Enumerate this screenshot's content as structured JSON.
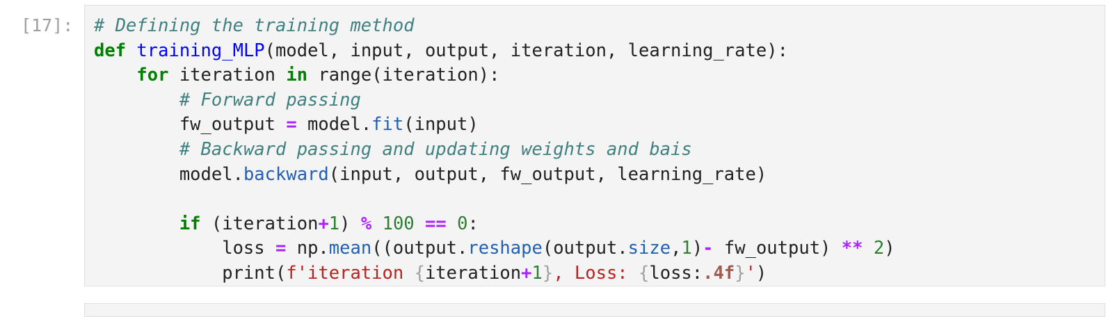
{
  "cell": {
    "prompt": "[17]:",
    "lines": [
      [
        {
          "t": "cm",
          "v": "# Defining the training method"
        }
      ],
      [
        {
          "t": "kw",
          "v": "def"
        },
        {
          "t": "tx",
          "v": " "
        },
        {
          "t": "fn",
          "v": "training_MLP"
        },
        {
          "t": "tx",
          "v": "(model, input, output, iteration, learning_rate):"
        }
      ],
      [
        {
          "t": "tx",
          "v": "    "
        },
        {
          "t": "kw",
          "v": "for"
        },
        {
          "t": "tx",
          "v": " iteration "
        },
        {
          "t": "kw",
          "v": "in"
        },
        {
          "t": "tx",
          "v": " range(iteration):"
        }
      ],
      [
        {
          "t": "tx",
          "v": "        "
        },
        {
          "t": "cm",
          "v": "# Forward passing"
        }
      ],
      [
        {
          "t": "tx",
          "v": "        fw_output "
        },
        {
          "t": "op",
          "v": "="
        },
        {
          "t": "tx",
          "v": " model."
        },
        {
          "t": "at",
          "v": "fit"
        },
        {
          "t": "tx",
          "v": "(input)"
        }
      ],
      [
        {
          "t": "tx",
          "v": "        "
        },
        {
          "t": "cm",
          "v": "# Backward passing and updating weights and bais"
        }
      ],
      [
        {
          "t": "tx",
          "v": "        model."
        },
        {
          "t": "at",
          "v": "backward"
        },
        {
          "t": "tx",
          "v": "(input, output, fw_output, learning_rate)"
        }
      ],
      [
        {
          "t": "tx",
          "v": ""
        }
      ],
      [
        {
          "t": "tx",
          "v": "        "
        },
        {
          "t": "kw",
          "v": "if"
        },
        {
          "t": "tx",
          "v": " (iteration"
        },
        {
          "t": "op",
          "v": "+"
        },
        {
          "t": "nm",
          "v": "1"
        },
        {
          "t": "tx",
          "v": ") "
        },
        {
          "t": "op",
          "v": "%"
        },
        {
          "t": "tx",
          "v": " "
        },
        {
          "t": "nm",
          "v": "100"
        },
        {
          "t": "tx",
          "v": " "
        },
        {
          "t": "op",
          "v": "=="
        },
        {
          "t": "tx",
          "v": " "
        },
        {
          "t": "nm",
          "v": "0"
        },
        {
          "t": "tx",
          "v": ":"
        }
      ],
      [
        {
          "t": "tx",
          "v": "            loss "
        },
        {
          "t": "op",
          "v": "="
        },
        {
          "t": "tx",
          "v": " np."
        },
        {
          "t": "at",
          "v": "mean"
        },
        {
          "t": "tx",
          "v": "((output."
        },
        {
          "t": "at",
          "v": "reshape"
        },
        {
          "t": "tx",
          "v": "(output."
        },
        {
          "t": "at",
          "v": "size"
        },
        {
          "t": "tx",
          "v": ","
        },
        {
          "t": "nm",
          "v": "1"
        },
        {
          "t": "tx",
          "v": ")"
        },
        {
          "t": "op",
          "v": "-"
        },
        {
          "t": "tx",
          "v": " fw_output) "
        },
        {
          "t": "op",
          "v": "**"
        },
        {
          "t": "tx",
          "v": " "
        },
        {
          "t": "nm",
          "v": "2"
        },
        {
          "t": "tx",
          "v": ")"
        }
      ],
      [
        {
          "t": "tx",
          "v": "            print("
        },
        {
          "t": "st",
          "v": "f'iteration "
        },
        {
          "t": "si",
          "v": "{"
        },
        {
          "t": "tx",
          "v": "iteration"
        },
        {
          "t": "op",
          "v": "+"
        },
        {
          "t": "nm",
          "v": "1"
        },
        {
          "t": "si",
          "v": "}"
        },
        {
          "t": "st",
          "v": ", Loss: "
        },
        {
          "t": "si",
          "v": "{"
        },
        {
          "t": "tx",
          "v": "loss:"
        },
        {
          "t": "sp",
          "v": ".4f"
        },
        {
          "t": "si",
          "v": "}"
        },
        {
          "t": "st",
          "v": "'"
        },
        {
          "t": "tx",
          "v": ")"
        }
      ]
    ]
  },
  "colors": {
    "comment": "#408080",
    "keyword": "#008000",
    "function": "#0000ff",
    "attribute": "#2160b0",
    "operator": "#aa22ff",
    "number": "#2e7d32",
    "string": "#ba2121",
    "editor_bg": "#f4f4f4",
    "prompt": "#9e9e9e"
  }
}
